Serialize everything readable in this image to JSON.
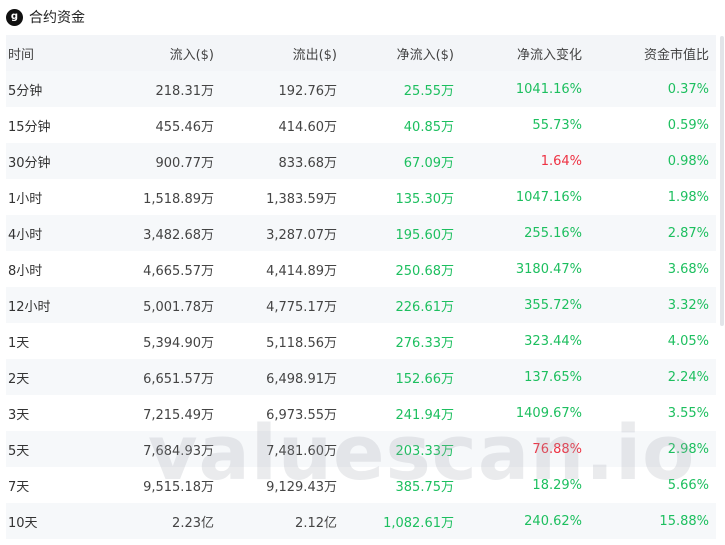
{
  "header": {
    "logo_glyph": "g",
    "title": "合约资金"
  },
  "colors": {
    "positive": "#1dbf5f",
    "negative": "#ee3344"
  },
  "table": {
    "columns": [
      "时间",
      "流入($)",
      "流出($)",
      "净流入($)",
      "净流入变化",
      "资金市值比"
    ],
    "rows": [
      {
        "time": "5分钟",
        "inflow": "218.31万",
        "outflow": "192.76万",
        "net": "25.55万",
        "change": "1041.16%",
        "change_dir": "up",
        "ratio": "0.37%"
      },
      {
        "time": "15分钟",
        "inflow": "455.46万",
        "outflow": "414.60万",
        "net": "40.85万",
        "change": "55.73%",
        "change_dir": "up",
        "ratio": "0.59%"
      },
      {
        "time": "30分钟",
        "inflow": "900.77万",
        "outflow": "833.68万",
        "net": "67.09万",
        "change": "1.64%",
        "change_dir": "down",
        "ratio": "0.98%"
      },
      {
        "time": "1小时",
        "inflow": "1,518.89万",
        "outflow": "1,383.59万",
        "net": "135.30万",
        "change": "1047.16%",
        "change_dir": "up",
        "ratio": "1.98%"
      },
      {
        "time": "4小时",
        "inflow": "3,482.68万",
        "outflow": "3,287.07万",
        "net": "195.60万",
        "change": "255.16%",
        "change_dir": "up",
        "ratio": "2.87%"
      },
      {
        "time": "8小时",
        "inflow": "4,665.57万",
        "outflow": "4,414.89万",
        "net": "250.68万",
        "change": "3180.47%",
        "change_dir": "up",
        "ratio": "3.68%"
      },
      {
        "time": "12小时",
        "inflow": "5,001.78万",
        "outflow": "4,775.17万",
        "net": "226.61万",
        "change": "355.72%",
        "change_dir": "up",
        "ratio": "3.32%"
      },
      {
        "time": "1天",
        "inflow": "5,394.90万",
        "outflow": "5,118.56万",
        "net": "276.33万",
        "change": "323.44%",
        "change_dir": "up",
        "ratio": "4.05%"
      },
      {
        "time": "2天",
        "inflow": "6,651.57万",
        "outflow": "6,498.91万",
        "net": "152.66万",
        "change": "137.65%",
        "change_dir": "up",
        "ratio": "2.24%"
      },
      {
        "time": "3天",
        "inflow": "7,215.49万",
        "outflow": "6,973.55万",
        "net": "241.94万",
        "change": "1409.67%",
        "change_dir": "up",
        "ratio": "3.55%"
      },
      {
        "time": "5天",
        "inflow": "7,684.93万",
        "outflow": "7,481.60万",
        "net": "203.33万",
        "change": "76.88%",
        "change_dir": "down",
        "ratio": "2.98%"
      },
      {
        "time": "7天",
        "inflow": "9,515.18万",
        "outflow": "9,129.43万",
        "net": "385.75万",
        "change": "18.29%",
        "change_dir": "up",
        "ratio": "5.66%"
      },
      {
        "time": "10天",
        "inflow": "2.23亿",
        "outflow": "2.12亿",
        "net": "1,082.61万",
        "change": "240.62%",
        "change_dir": "up",
        "ratio": "15.88%"
      }
    ]
  },
  "watermark": "valuescan.io"
}
